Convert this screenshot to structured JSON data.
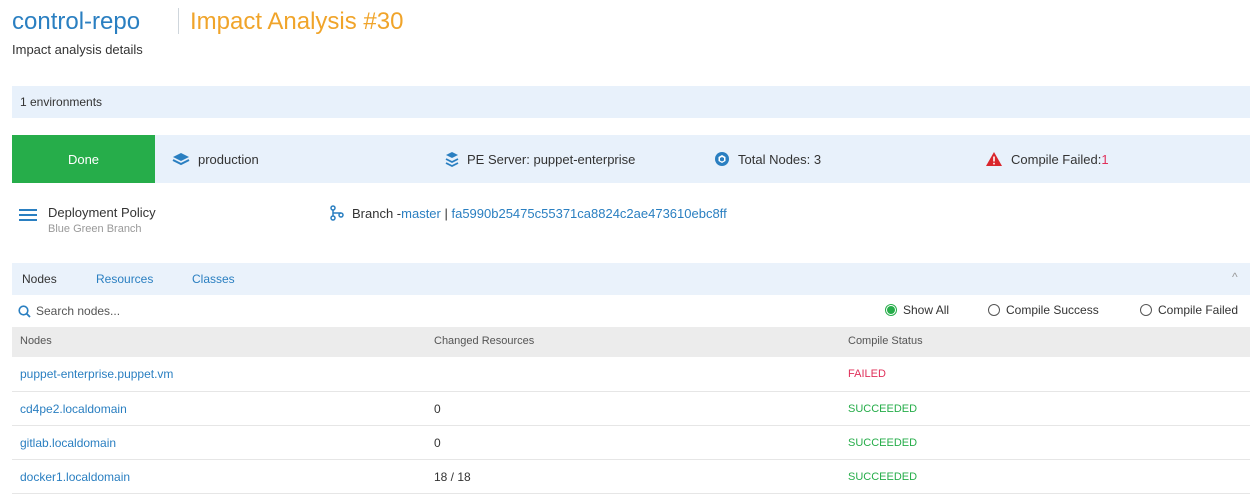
{
  "header": {
    "repo": "control-repo",
    "title": "Impact Analysis #30",
    "subtitle": "Impact analysis details"
  },
  "environments": {
    "count_label": "1 environments"
  },
  "status_row": {
    "done": "Done",
    "environment": "production",
    "server": "PE Server: puppet-enterprise",
    "total_nodes": "Total Nodes: 3",
    "compile_failed_label": "Compile Failed: ",
    "compile_failed_count": "1"
  },
  "policy": {
    "title": "Deployment Policy",
    "subtitle": "Blue Green Branch",
    "branch_prefix": "Branch - ",
    "branch": "master",
    "separator": " | ",
    "commit": "fa5990b25475c55371ca8824c2ae473610ebc8ff"
  },
  "tabs": [
    "Nodes",
    "Resources",
    "Classes"
  ],
  "collapse_icon": "^",
  "search": {
    "placeholder": "Search nodes..."
  },
  "filters": [
    "Show All",
    "Compile Success",
    "Compile Failed"
  ],
  "table": {
    "headers": [
      "Nodes",
      "Changed Resources",
      "Compile Status"
    ],
    "rows": [
      {
        "node": "puppet-enterprise.puppet.vm",
        "changed": "",
        "status": "FAILED"
      },
      {
        "node": "cd4pe2.localdomain",
        "changed": "0",
        "status": "SUCCEEDED"
      },
      {
        "node": "gitlab.localdomain",
        "changed": "0",
        "status": "SUCCEEDED"
      },
      {
        "node": "docker1.localdomain",
        "changed": "18 / 18",
        "status": "SUCCEEDED"
      }
    ]
  },
  "colors": {
    "accent": "#2a7fc1",
    "title_orange": "#f0a42a",
    "success": "#26ad4a",
    "failure": "#e0305a"
  },
  "icons": {
    "environment": "layers-icon",
    "server": "stack-icon",
    "nodes": "cube-cluster-icon",
    "failed": "warning-triangle-icon",
    "policy": "list-icon",
    "branch": "git-branch-icon",
    "search": "search-icon"
  }
}
